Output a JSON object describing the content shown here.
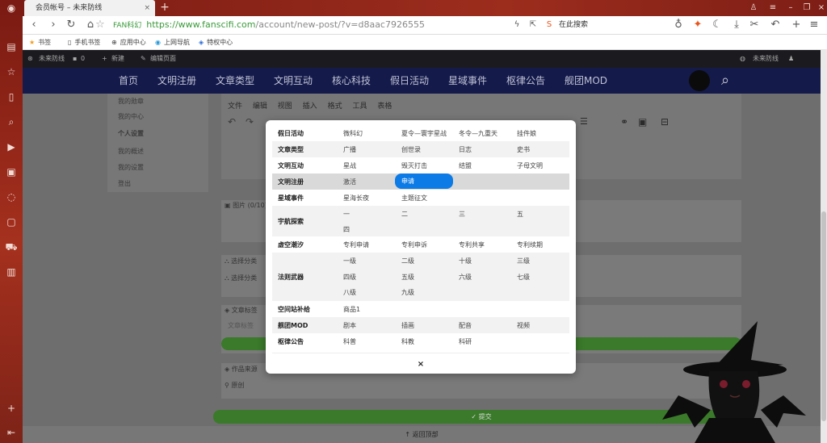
{
  "browser": {
    "tab_title": "会员帐号 – 未来防线",
    "tab_close": "×",
    "new_tab": "+",
    "address": {
      "site_badge": "FAN科幻",
      "scheme_host": "https://www.fanscifi.com",
      "path": "/account/new-post/?v=d8aac7926555"
    },
    "search_placeholder": "在此搜索",
    "bookmarks": [
      {
        "label": "书签"
      },
      {
        "label": "手机书签"
      },
      {
        "label": "应用中心"
      },
      {
        "label": "上网导航"
      },
      {
        "label": "特权中心"
      }
    ]
  },
  "wp_admin_bar": {
    "site_name": "未来防线",
    "comments": "0",
    "new_label": "新建",
    "edit_label": "编辑页面",
    "user_name": "未来防线"
  },
  "site_nav": {
    "items": [
      "首页",
      "文明注册",
      "文章类型",
      "文明互动",
      "核心科技",
      "假日活动",
      "星域事件",
      "枢律公告",
      "舰团MOD"
    ]
  },
  "sidebar": {
    "items": [
      "我的勋章",
      "我的中心",
      "个人设置",
      "我的概述",
      "我的设置",
      "登出"
    ]
  },
  "editor": {
    "menu": [
      "文件",
      "编辑",
      "视图",
      "插入",
      "格式",
      "工具",
      "表格"
    ]
  },
  "form_labels": {
    "image": "图片 (0/10)",
    "category": "选择分类",
    "category_field": "选择分类",
    "article_tag": "文章标签",
    "article_tag_field": "文章标签",
    "source": "作品来源",
    "source_value": "原创",
    "submit": "提交",
    "back_to_top": "返回顶部"
  },
  "category_modal": {
    "rows": [
      {
        "name": "假日活动",
        "options": [
          "微科幻",
          "夏令—寰宇星战",
          "冬令—九重天",
          "挂件娘"
        ]
      },
      {
        "name": "文章类型",
        "options": [
          "广播",
          "创世录",
          "日志",
          "史书"
        ]
      },
      {
        "name": "文明互动",
        "options": [
          "星战",
          "毁灭打击",
          "结盟",
          "子母文明"
        ]
      },
      {
        "name": "文明注册",
        "options": [
          "激活",
          "申请"
        ],
        "selected": "申请"
      },
      {
        "name": "星域事件",
        "options": [
          "星海长夜",
          "主题征文"
        ]
      },
      {
        "name": "宇航探索",
        "options": [
          "一",
          "二",
          "三",
          "五",
          "四"
        ]
      },
      {
        "name": "虚空潮汐",
        "options": [
          "专利申请",
          "专利申诉",
          "专利共享",
          "专利续期"
        ]
      },
      {
        "name": "法则武器",
        "options": [
          "一级",
          "二级",
          "十级",
          "三级",
          "四级",
          "五级",
          "六级",
          "七级",
          "八级",
          "九级"
        ]
      },
      {
        "name": "空间站补给",
        "options": [
          "商品1"
        ]
      },
      {
        "name": "舰团MOD",
        "options": [
          "剧本",
          "插画",
          "配音",
          "视频"
        ]
      },
      {
        "name": "枢律公告",
        "options": [
          "科普",
          "科教",
          "科研"
        ]
      }
    ],
    "close_label": "×"
  }
}
